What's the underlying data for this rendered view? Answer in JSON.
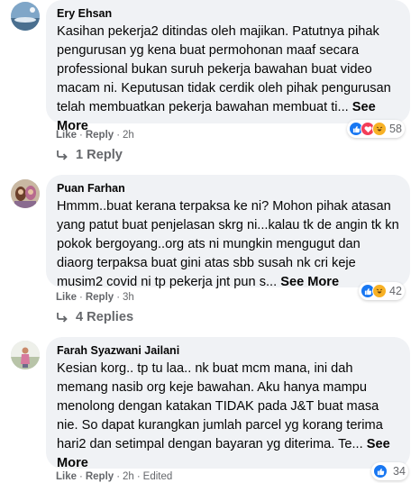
{
  "comments": [
    {
      "author": "Ery Ehsan",
      "text": "Kasihan pekerja2 ditindas oleh majikan. Patutnya pihak pengurusan yg kena buat permohonan maaf secara professional bukan suruh pekerja bawahan buat video macam ni. Keputusan tidak cerdik oleh pihak pengurusan telah membuatkan pekerja bawahan membuat ti...",
      "see_more": "See More",
      "like": "Like",
      "reply": "Reply",
      "time": "2h",
      "edited": "",
      "reaction_count": "58",
      "reaction_icons": [
        "like-icon",
        "love-icon",
        "haha-icon"
      ],
      "replies_label": "1 Reply"
    },
    {
      "author": "Puan Farhan",
      "text": "Hmmm..buat kerana terpaksa ke ni? Mohon pihak atasan yang patut buat penjelasan skrg ni...kalau tk de angin tk kn pokok bergoyang..org ats ni mungkin mengugut dan diaorg terpaksa buat gini atas sbb susah nk cri keje musim2 covid ni tp pekerja jnt pun s...",
      "see_more": "See More",
      "like": "Like",
      "reply": "Reply",
      "time": "3h",
      "edited": "",
      "reaction_count": "42",
      "reaction_icons": [
        "like-icon",
        "haha-icon"
      ],
      "replies_label": "4 Replies"
    },
    {
      "author": "Farah Syazwani Jailani",
      "text": "Kesian korg.. tp tu laa.. nk buat mcm mana, ini dah memang nasib org keje bawahan. Aku hanya mampu menolong dengan katakan TIDAK pada J&T buat masa nie. So dapat kurangkan jumlah parcel yg korang terima hari2 dan setimpal dengan bayaran yg diterima. Te...",
      "see_more": "See More",
      "like": "Like",
      "reply": "Reply",
      "time": "2h",
      "edited": "Edited",
      "reaction_count": "34",
      "reaction_icons": [
        "like-icon"
      ],
      "replies_label": ""
    }
  ],
  "colors": {
    "bubble": "#f0f2f5",
    "meta": "#65676b",
    "like_blue": "#1877f2",
    "love_red": "#f33e58",
    "haha_yellow": "#f7b125"
  }
}
